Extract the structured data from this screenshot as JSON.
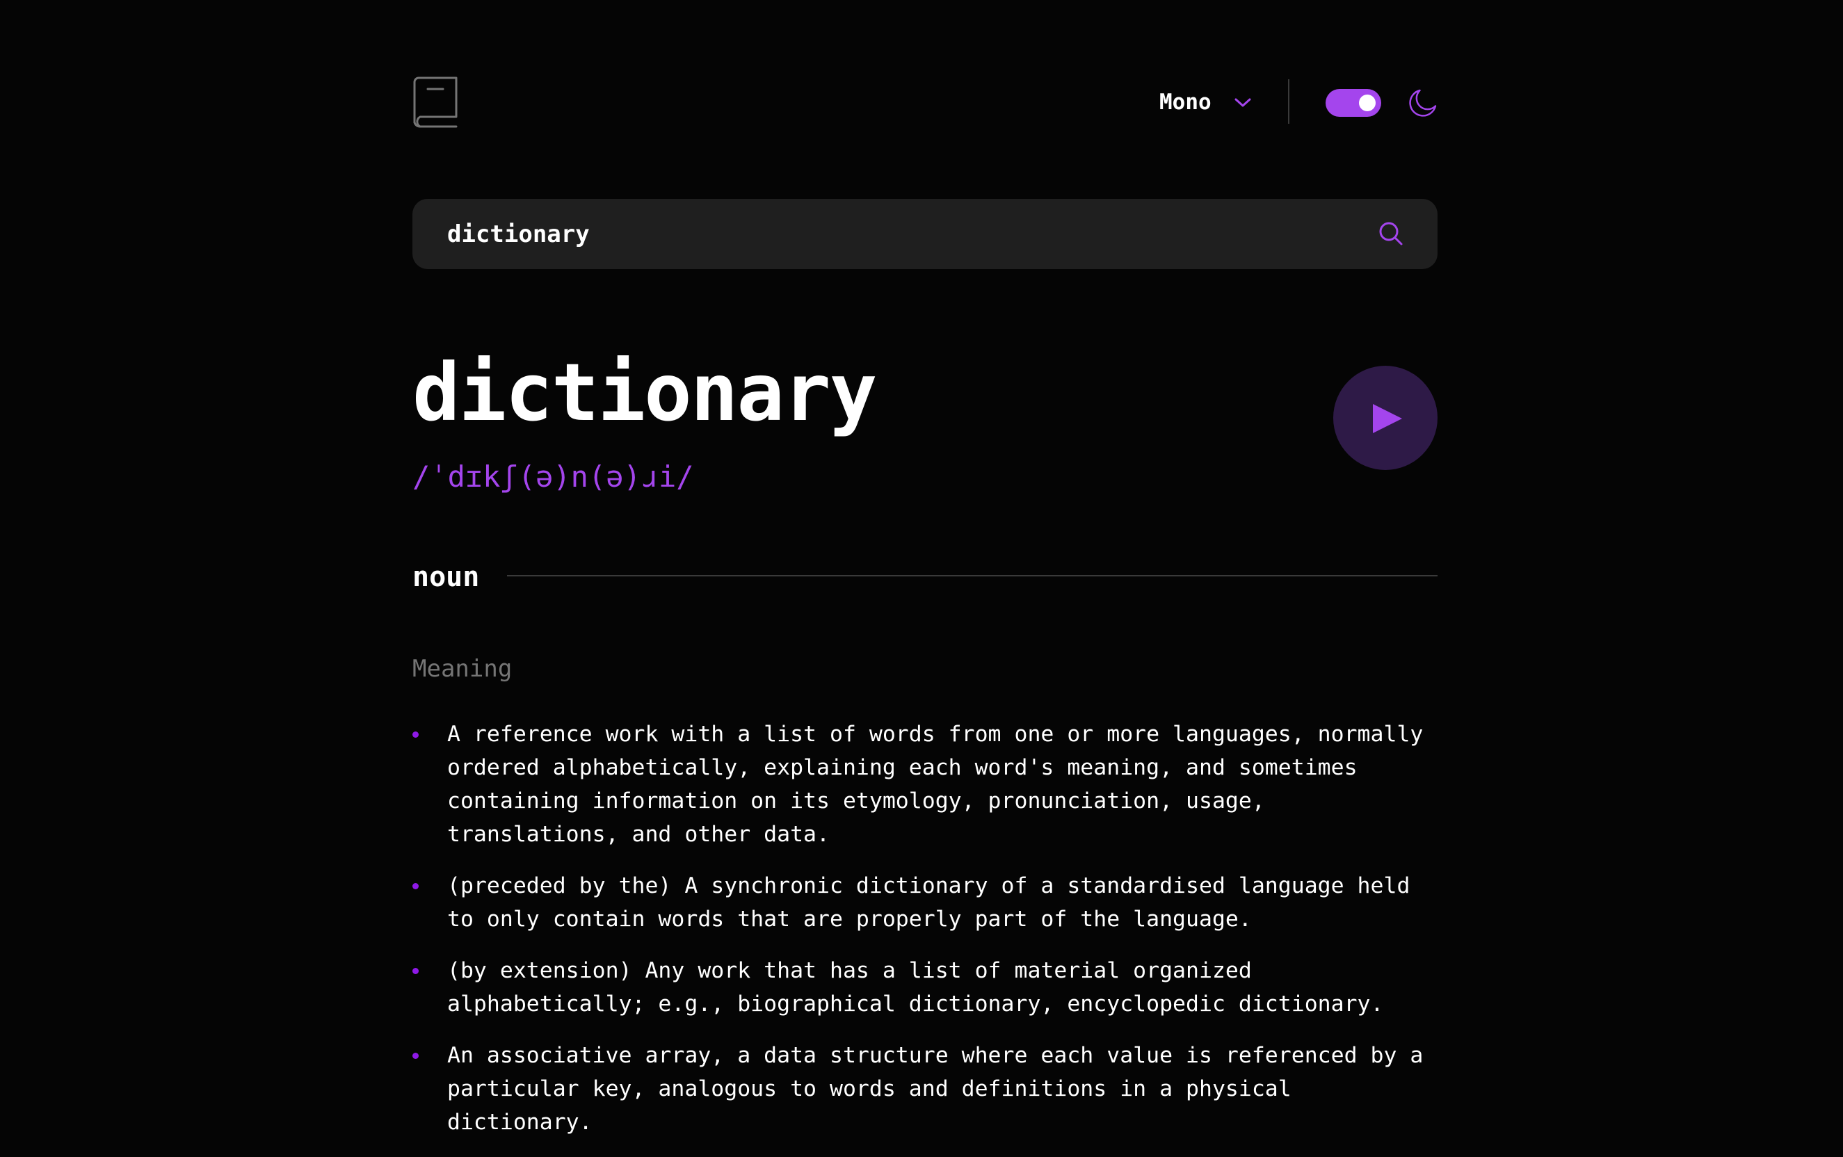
{
  "header": {
    "logo_icon": "book-icon",
    "font": {
      "selected": "Mono",
      "icon": "chevron-down-icon"
    },
    "theme_toggle": {
      "state": "on",
      "color": "#a445ed"
    },
    "theme_icon": "moon-icon"
  },
  "search": {
    "value": "dictionary",
    "icon": "search-icon"
  },
  "entry": {
    "word": "dictionary",
    "phonetic": "/ˈdɪkʃ(ə)n(ə)ɹi/",
    "play_icon": "play-icon",
    "meanings": [
      {
        "part_of_speech": "noun",
        "meaning_label": "Meaning",
        "definitions": [
          "A reference work with a list of words from one or more languages, normally ordered alphabetically, explaining each word's meaning, and sometimes containing information on its etymology, pronunciation, usage, translations, and other data.",
          "(preceded by the) A synchronic dictionary of a standardised language held to only contain words that are properly part of the language.",
          "(by extension) Any work that has a list of material organized alphabetically; e.g., biographical dictionary, encyclopedic dictionary.",
          "An associative array, a data structure where each value is referenced by a particular key, analogous to words and definitions in a physical dictionary."
        ]
      }
    ]
  },
  "colors": {
    "background": "#050505",
    "accent": "#a445ed",
    "search_bg": "#1f1f1f",
    "muted_text": "#757575",
    "play_bg": "#2e1a47"
  }
}
